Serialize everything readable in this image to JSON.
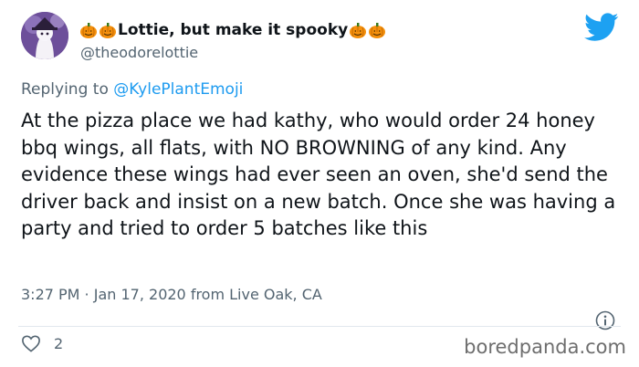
{
  "author": {
    "name_emoji_prefix": "🎃🎃",
    "display_name": "Lottie, but make it spooky",
    "name_emoji_suffix": "🎃🎃",
    "handle": "@theodorelottie"
  },
  "reply": {
    "prefix": "Replying to ",
    "mention": "@KylePlantEmoji"
  },
  "tweet": {
    "text": "At the pizza place we had kathy, who would order 24 honey bbq wings, all flats, with NO BROWNING of any kind. Any evidence these wings had ever seen an oven, she'd send the driver back and insist on a new batch. Once she was having a party and tried to order 5 batches like this",
    "timestamp": "3:27 PM · Jan 17, 2020 from Live Oak, CA"
  },
  "engagement": {
    "likes": "2"
  },
  "watermark": "boredpanda.com",
  "colors": {
    "link": "#1d9bf0",
    "muted": "#536471",
    "twitter_blue": "#1da1f2"
  },
  "icons": [
    "avatar",
    "pumpkin-icon",
    "twitter-bird-icon",
    "info-icon",
    "heart-icon"
  ]
}
